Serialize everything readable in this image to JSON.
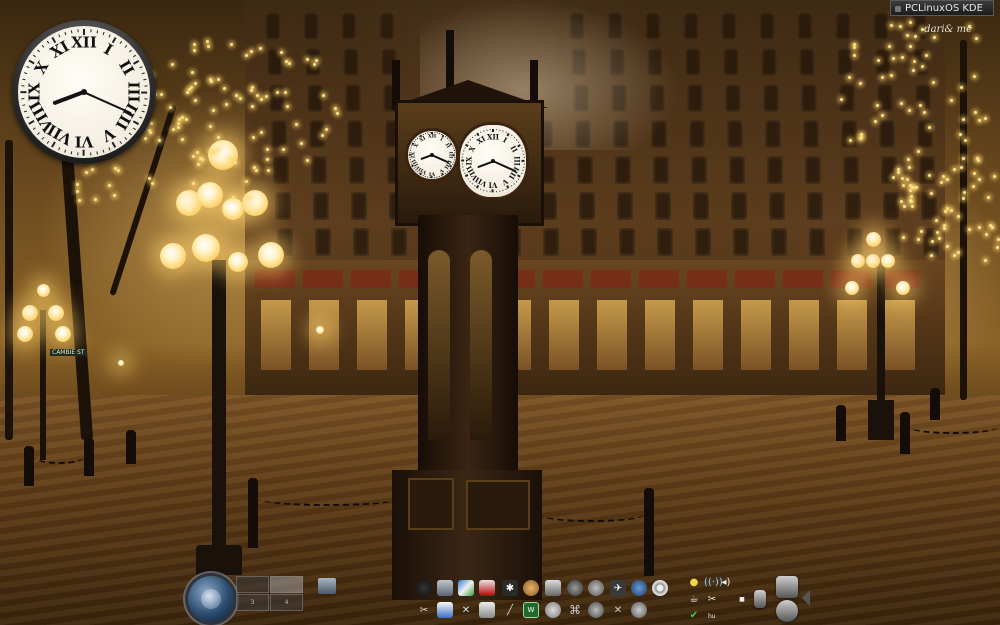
{
  "top_bar": {
    "os_label": "PCLinuxOS KDE",
    "signature": "dari& me"
  },
  "desktop_clock": {
    "numerals": [
      "XII",
      "I",
      "II",
      "III",
      "IIII",
      "V",
      "VI",
      "VII",
      "VIII",
      "IX",
      "X",
      "XI"
    ],
    "time": "8:19"
  },
  "street_signs": [
    "CAMBIE ST"
  ],
  "panel": {
    "pager_desktops": [
      "1",
      "2",
      "3",
      "4"
    ],
    "active_desktop": "2",
    "launchers_row1": [
      "konqueror-icon",
      "package-icon",
      "image-viewer-icon",
      "pdf-reader-icon",
      "network-icon",
      "disc-burner-icon",
      "photo-editor-icon",
      "settings-icon",
      "system-monitor-icon",
      "update-icon",
      "chat-icon",
      "media-player-icon"
    ],
    "launchers_row2": [
      "tools-icon",
      "text-editor-icon",
      "control-center-icon",
      "printer-icon",
      "terminal-icon",
      "spreadsheet-icon",
      "firewall-icon",
      "swirl-icon",
      "audio-icon",
      "tools-icon-2",
      "camera-icon"
    ],
    "tray_keyboard_layout": "hu",
    "colors": {
      "panel_text": "#eeeeee",
      "badge_bg": "#2b2b2b"
    }
  }
}
